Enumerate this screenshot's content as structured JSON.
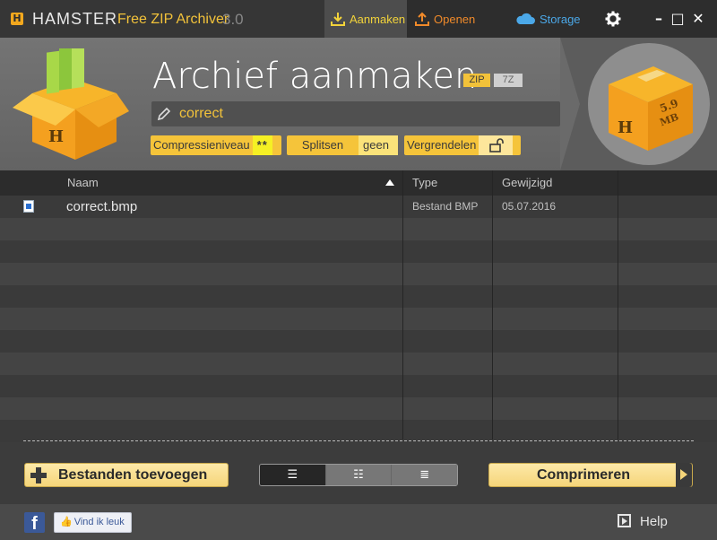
{
  "titlebar": {
    "logo_letter": "H",
    "brand": "HAMSTER",
    "product": "Free ZIP Archiver",
    "version": "3.0",
    "tabs": [
      {
        "label": "Aanmaken",
        "icon": "download-icon",
        "active": true
      },
      {
        "label": "Openen",
        "icon": "upload-icon",
        "active": false
      },
      {
        "label": "Storage",
        "icon": "cloud-icon",
        "active": false
      }
    ],
    "settings_icon": "gear-icon",
    "window_buttons": {
      "minimize": "–",
      "maximize": "□",
      "close": "✕"
    }
  },
  "header": {
    "title": "Archief aanmaken",
    "formats": [
      "ZIP",
      "7Z"
    ],
    "selected_format": "ZIP",
    "archive_name": "correct",
    "compression": {
      "label": "Compressieniveau",
      "value": "**"
    },
    "split": {
      "label": "Splitsen",
      "value": "geen"
    },
    "lock": {
      "label": "Vergrendelen",
      "icon": "unlock-icon"
    },
    "size_box": {
      "value": "5.9",
      "unit": "MB",
      "letter": "H"
    }
  },
  "columns": {
    "name": "Naam",
    "type": "Type",
    "modified": "Gewijzigd",
    "sort": "ascending"
  },
  "files": [
    {
      "name": "correct.bmp",
      "type": "Bestand BMP",
      "modified": "05.07.2016",
      "icon": "bmp-file-icon"
    }
  ],
  "buttons": {
    "add": "Bestanden toevoegen",
    "compress": "Comprimeren",
    "views": [
      {
        "icon": "list-view-icon",
        "active": true
      },
      {
        "icon": "detail-list-icon",
        "active": false
      },
      {
        "icon": "compact-list-icon",
        "active": false
      }
    ]
  },
  "footer": {
    "facebook": "f",
    "like": "Vind ik leuk",
    "help": "Help"
  },
  "colors": {
    "accent_yellow": "#f2c23a",
    "tab_open": "#f08a2a",
    "tab_storage": "#4ba8e8",
    "background": "#3c3c3c"
  }
}
